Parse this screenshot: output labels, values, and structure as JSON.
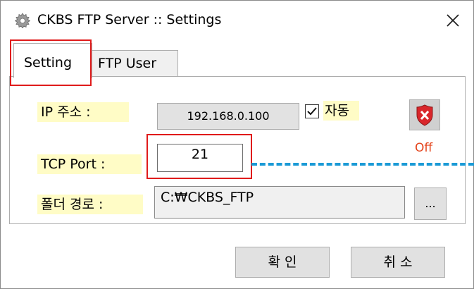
{
  "window": {
    "title": "CKBS FTP Server :: Settings",
    "app_icon": "gear-icon",
    "close_icon": "close-icon"
  },
  "tabs": [
    {
      "label": "Setting",
      "active": true
    },
    {
      "label": "FTP User",
      "active": false
    }
  ],
  "form": {
    "ip_label": "IP 주소 :",
    "ip_value": "192.168.0.100",
    "auto_label": "자동",
    "auto_checked": true,
    "port_label": "TCP Port :",
    "port_value": "21",
    "folder_label": "폴더 경로 :",
    "folder_value": "C:₩CKBS_FTP",
    "browse_label": "..."
  },
  "status": {
    "icon": "shield-x-icon",
    "text": "Off",
    "color": "#e4451d"
  },
  "buttons": {
    "ok_label": "확 인",
    "cancel_label": "취 소"
  },
  "colors": {
    "highlight": "#e01b1b",
    "label_bg": "#fffcc6",
    "dash": "#1a9ad6"
  }
}
